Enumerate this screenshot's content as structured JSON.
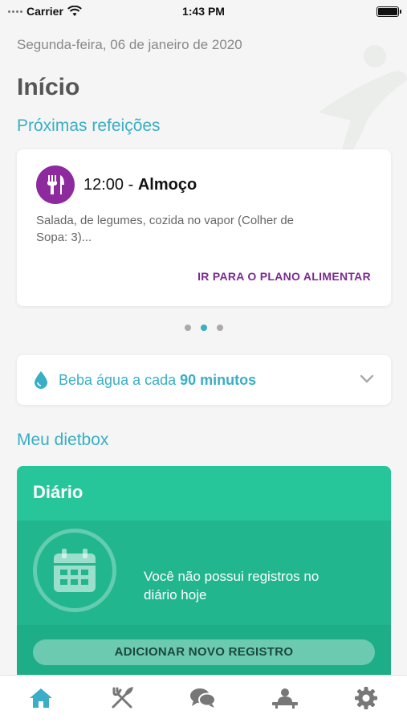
{
  "status_bar": {
    "carrier": "Carrier",
    "time": "1:43 PM"
  },
  "header": {
    "date": "Segunda-feira, 06 de janeiro de 2020",
    "title": "Início"
  },
  "next_meals": {
    "section_title": "Próximas refeições",
    "card": {
      "icon": "cutlery-icon",
      "time": "12:00",
      "separator": " - ",
      "name": "Almoço",
      "description": "Salada, de legumes, cozida no vapor (Colher de Sopa: 3)...",
      "link": "IR PARA O PLANO ALIMENTAR"
    },
    "pager": {
      "count": 3,
      "active_index": 1
    }
  },
  "water": {
    "icon": "water-drop-icon",
    "text_prefix": "Beba água a cada ",
    "interval": "90 minutos"
  },
  "dietbox": {
    "section_title": "Meu dietbox",
    "diario": {
      "title": "Diário",
      "icon": "calendar-icon",
      "message": "Você não possui registros no diário hoje",
      "button": "ADICIONAR NOVO REGISTRO"
    }
  },
  "tab_bar": {
    "items": [
      {
        "icon": "home-icon",
        "active": true
      },
      {
        "icon": "cutlery-icon",
        "active": false
      },
      {
        "icon": "chat-icon",
        "active": false
      },
      {
        "icon": "nutritionist-icon",
        "active": false
      },
      {
        "icon": "gear-icon",
        "active": false
      }
    ]
  },
  "colors": {
    "accent": "#3aaec4",
    "meal_purple": "#8c2a9e",
    "diario_green": "#24be94",
    "tab_active": "#3aaec4",
    "tab_inactive": "#777777"
  }
}
